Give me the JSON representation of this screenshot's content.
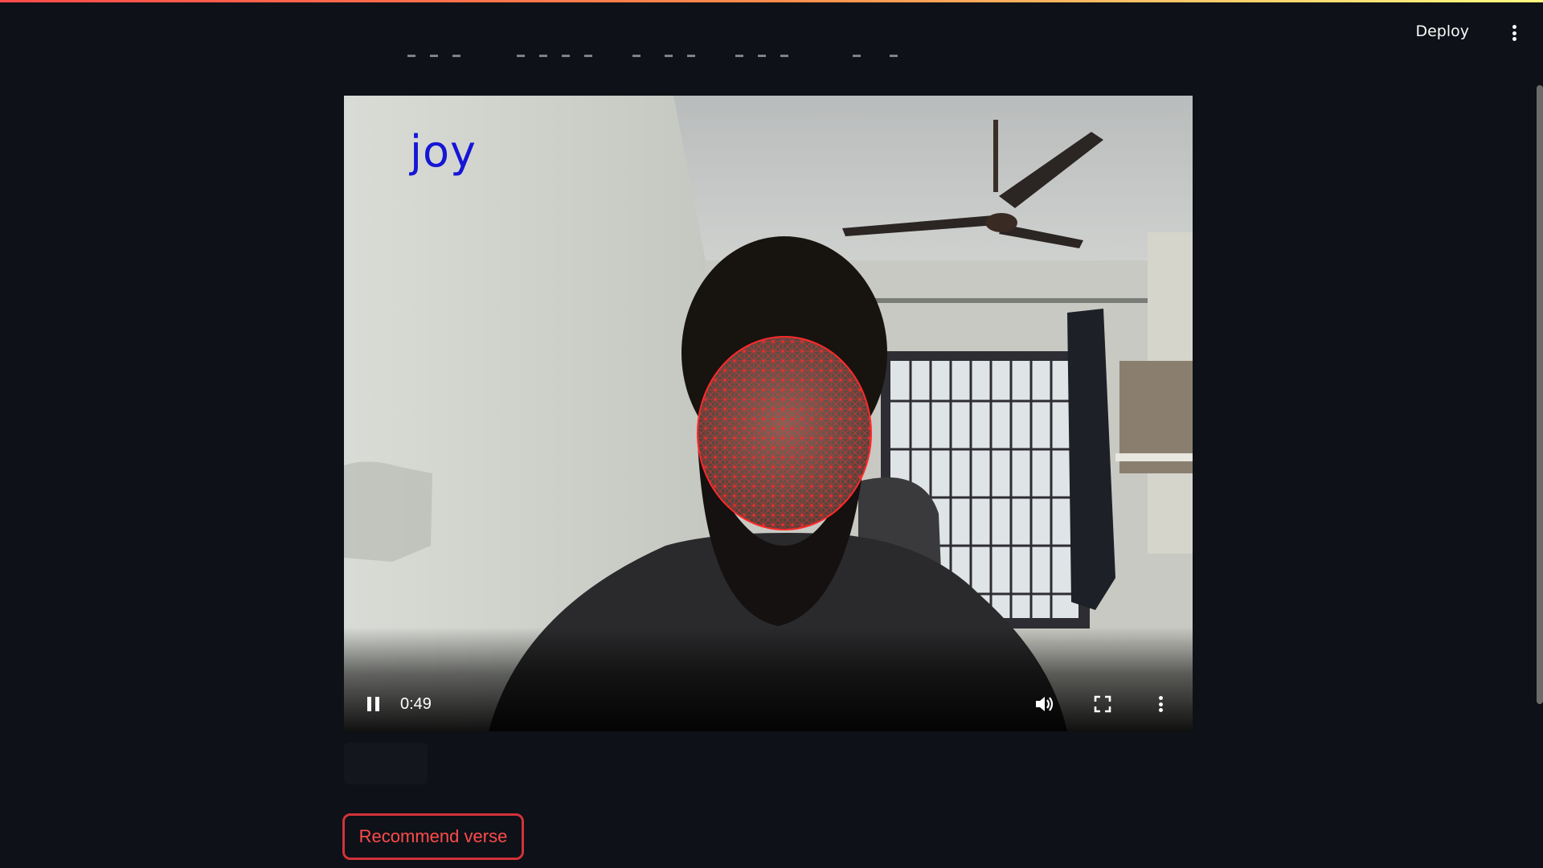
{
  "header": {
    "deploy_label": "Deploy"
  },
  "video": {
    "emotion_label": "joy",
    "time": "0:49",
    "playing": true
  },
  "actions": {
    "recommend_label": "Recommend verse"
  },
  "icons": {
    "menu": "dots-vertical-icon",
    "pause": "pause-icon",
    "volume": "volume-icon",
    "fullscreen": "fullscreen-icon",
    "more": "more-vertical-icon"
  },
  "colors": {
    "background": "#0e1117",
    "accent": "#ff4b4b",
    "emotion_text": "#1616d6",
    "mesh": "#ff2a2a"
  }
}
